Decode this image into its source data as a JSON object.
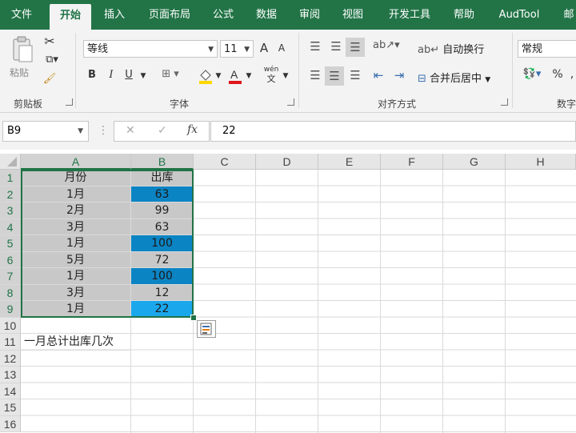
{
  "tabs": [
    "文件",
    "开始",
    "插入",
    "页面布局",
    "公式",
    "数据",
    "审阅",
    "视图",
    "开发工具",
    "帮助",
    "AudTool",
    "邮"
  ],
  "active_tab": "开始",
  "ribbon": {
    "clipboard": {
      "paste": "粘贴",
      "label": "剪贴板"
    },
    "font": {
      "name": "等线",
      "size": "11",
      "label": "字体",
      "bold": "B",
      "italic": "I",
      "underline": "U",
      "phonetic_top": "wén",
      "phonetic_bottom": "文",
      "grow": "A",
      "shrink": "A"
    },
    "alignment": {
      "wrap": "自动换行",
      "merge": "合并后居中",
      "label": "对齐方式"
    },
    "number": {
      "format": "常规",
      "percent": "%",
      "label": "数字"
    }
  },
  "formula_bar": {
    "name_box": "B9",
    "cancel": "✕",
    "enter": "✓",
    "fx": "fx",
    "value": "22"
  },
  "columns": [
    "A",
    "B",
    "C",
    "D",
    "E",
    "F",
    "G",
    "H"
  ],
  "rows": [
    "1",
    "2",
    "3",
    "4",
    "5",
    "6",
    "7",
    "8",
    "9",
    "10",
    "11",
    "12",
    "13",
    "14",
    "15",
    "16"
  ],
  "cells": {
    "a1": "月份",
    "b1": "出库",
    "a2": "1月",
    "b2": "63",
    "a3": "2月",
    "b3": "99",
    "a4": "3月",
    "b4": "63",
    "a5": "1月",
    "b5": "100",
    "a6": "5月",
    "b6": "72",
    "a7": "1月",
    "b7": "100",
    "a8": "3月",
    "b8": "12",
    "a9": "1月",
    "b9": "22",
    "a11": "一月总计出库几次"
  },
  "colors": {
    "excel_green": "#217346",
    "highlight_blue": "#0b84c4",
    "highlight_bright": "#1aa7ec",
    "selection_gray": "#c8c8c8"
  }
}
